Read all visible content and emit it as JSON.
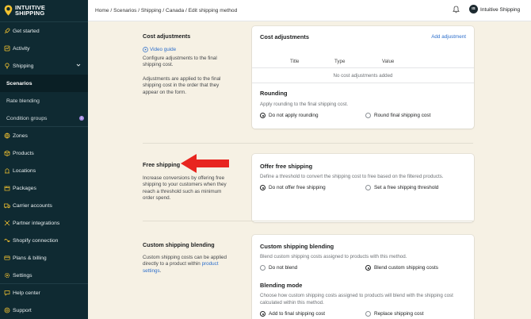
{
  "brand": {
    "line1": "INTUITIVE",
    "line2": "SHIPPING"
  },
  "topbar": {
    "breadcrumb": "Home / Scenarios / Shipping / Canada / Edit shipping method",
    "avatar_initials": "IS",
    "username": "Intuitive Shipping"
  },
  "sidebar": {
    "items": [
      {
        "label": "Get started",
        "icon": "rocket-icon"
      },
      {
        "label": "Activity",
        "icon": "activity-icon"
      },
      {
        "label": "Shipping",
        "icon": "bulb-icon"
      },
      {
        "label": "Scenarios"
      },
      {
        "label": "Rate blending"
      },
      {
        "label": "Condition groups",
        "badge": "i"
      },
      {
        "label": "Zones",
        "icon": "globe-icon"
      },
      {
        "label": "Products",
        "icon": "box-icon"
      },
      {
        "label": "Locations",
        "icon": "location-icon"
      },
      {
        "label": "Packages",
        "icon": "package-icon"
      },
      {
        "label": "Carrier accounts",
        "icon": "truck-icon"
      },
      {
        "label": "Partner integrations",
        "icon": "integration-icon"
      },
      {
        "label": "Shopify connection",
        "icon": "connection-icon"
      },
      {
        "label": "Plans & billing",
        "icon": "billing-icon"
      },
      {
        "label": "Settings",
        "icon": "gear-icon"
      },
      {
        "label": "Help center",
        "icon": "chat-icon"
      },
      {
        "label": "Support",
        "icon": "help-icon"
      }
    ]
  },
  "cost_adjustments": {
    "title": "Cost adjustments",
    "video_guide": "Video guide",
    "desc1": "Configure adjustments to the final shipping cost.",
    "desc2": "Adjustments are applied to the final shipping cost in the order that they appear on the form.",
    "card_title": "Cost adjustments",
    "add_link": "Add adjustment",
    "columns": [
      "Title",
      "Type",
      "Value"
    ],
    "empty": "No cost adjustments added",
    "rounding_title": "Rounding",
    "rounding_sub": "Apply rounding to the final shipping cost.",
    "opt_no_round": "Do not apply rounding",
    "opt_round": "Round final shipping cost"
  },
  "free_shipping": {
    "title": "Free shipping",
    "desc": "Increase conversions by offering free shipping to your customers when they reach a threshold such as minimum order spend.",
    "card_title": "Offer free shipping",
    "card_sub": "Define a threshold to convert the shipping cost to free based on the filtered products.",
    "opt_no": "Do not offer free shipping",
    "opt_yes": "Set a free shipping threshold"
  },
  "blending": {
    "title": "Custom shipping blending",
    "desc_pre": "Custom shipping costs can be applied directly to a product within ",
    "desc_link": "product settings",
    "desc_post": ".",
    "card_title": "Custom shipping blending",
    "card_sub": "Blend custom shipping costs assigned to products with this method.",
    "opt_no": "Do not blend",
    "opt_yes": "Blend custom shipping costs",
    "mode_title": "Blending mode",
    "mode_sub1": "Choose how custom shipping costs assigned to products will blend with the shipping cost",
    "mode_sub2": "calculated within this method.",
    "opt_add": "Add to final shipping cost",
    "opt_replace": "Replace shipping cost"
  },
  "colors": {
    "sidebar": "#0f2a32",
    "accent": "#2c6ecb",
    "arrow": "#e8251f",
    "page_bg": "#f6f1e4"
  }
}
